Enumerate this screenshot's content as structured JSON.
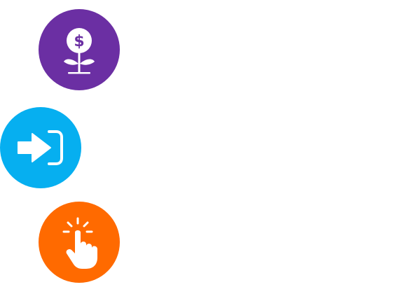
{
  "badges": [
    {
      "icon": "money-plant-icon",
      "color": "#6b2fa3"
    },
    {
      "icon": "login-arrow-icon",
      "color": "#06aff0"
    },
    {
      "icon": "tap-hand-icon",
      "color": "#ff6a00"
    }
  ]
}
